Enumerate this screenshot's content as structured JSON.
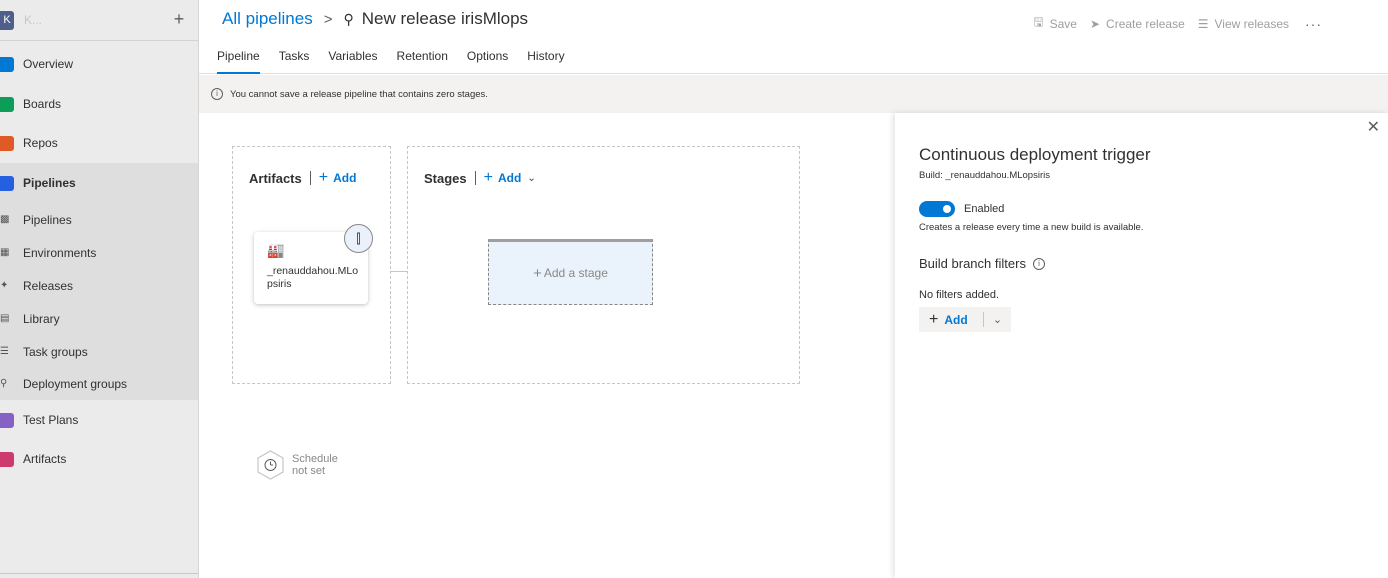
{
  "sidebar": {
    "org_initial": "K",
    "org_name": "K...",
    "add_icon": "plus",
    "items": [
      {
        "label": "Overview",
        "icon": "overview-icon",
        "color": "#0078d4"
      },
      {
        "label": "Boards",
        "icon": "boards-icon",
        "color": "#0c9d58"
      },
      {
        "label": "Repos",
        "icon": "repos-icon",
        "color": "#e05a28"
      },
      {
        "label": "Pipelines",
        "icon": "pipelines-icon",
        "color": "#2560e0"
      },
      {
        "label": "Pipelines",
        "icon": "pipelines-sub-icon"
      },
      {
        "label": "Environments",
        "icon": "environments-icon"
      },
      {
        "label": "Releases",
        "icon": "releases-icon"
      },
      {
        "label": "Library",
        "icon": "library-icon"
      },
      {
        "label": "Task groups",
        "icon": "task-groups-icon"
      },
      {
        "label": "Deployment groups",
        "icon": "deployment-groups-icon"
      },
      {
        "label": "Test Plans",
        "icon": "test-plans-icon",
        "color": "#8661c5"
      },
      {
        "label": "Artifacts",
        "icon": "artifacts-icon",
        "color": "#cc3a6e"
      }
    ]
  },
  "header": {
    "breadcrumb_root": "All pipelines",
    "breadcrumb_sep": ">",
    "title": "New release irisMlops",
    "toolbar": {
      "save": "Save",
      "create_release": "Create release",
      "view_releases": "View releases",
      "more": "···"
    },
    "tabs": [
      "Pipeline",
      "Tasks",
      "Variables",
      "Retention",
      "Options",
      "History"
    ],
    "active_tab": "Pipeline"
  },
  "warning": {
    "icon": "i",
    "text": "You cannot save a release pipeline that contains zero stages."
  },
  "canvas": {
    "artifacts": {
      "title": "Artifacts",
      "add_label": "Add",
      "card_name": "_renauddahou.MLopsiris",
      "trigger_icon": "lightning-icon",
      "schedule_line1": "Schedule",
      "schedule_line2": "not set"
    },
    "stages": {
      "title": "Stages",
      "add_label": "Add",
      "add_stage_label": "Add a stage"
    }
  },
  "panel": {
    "title": "Continuous deployment trigger",
    "subtitle": "Build: _renauddahou.MLopsiris",
    "toggle_label": "Enabled",
    "toggle_on": true,
    "toggle_desc": "Creates a release every time a new build is available.",
    "filters_title": "Build branch filters",
    "no_filters": "No filters added.",
    "add_label": "Add"
  },
  "colors": {
    "accent": "#0078d4",
    "sidebar_bg": "#ebebeb",
    "sidebar_active": "#dedede"
  }
}
